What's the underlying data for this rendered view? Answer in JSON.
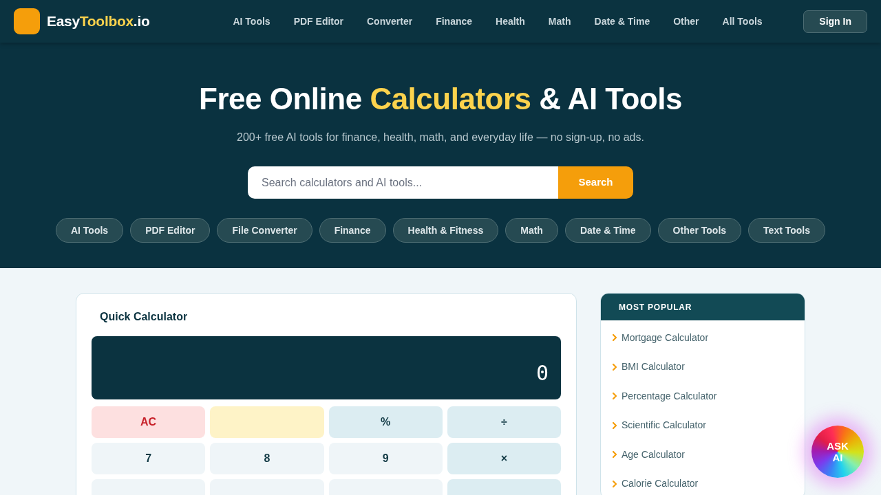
{
  "header": {
    "logo": {
      "parts": [
        {
          "text": "Easy",
          "highlight": false
        },
        {
          "text": "Toolbox",
          "highlight": true
        },
        {
          "text": ".io",
          "highlight": false
        }
      ]
    },
    "nav": [
      "AI Tools",
      "PDF Editor",
      "Converter",
      "Finance",
      "Health",
      "Math",
      "Date & Time",
      "Other",
      "All Tools"
    ],
    "sign_in": "Sign In"
  },
  "hero": {
    "title": [
      {
        "text": "Free Online ",
        "highlight": false
      },
      {
        "text": "Calculators",
        "highlight": true
      },
      {
        "text": " & AI Tools",
        "highlight": false
      }
    ],
    "subtitle": "200+ free AI tools for finance, health, math, and everyday life — no sign-up, no ads.",
    "search": {
      "placeholder": "Search calculators and AI tools...",
      "button": "Search"
    },
    "chips": [
      "AI Tools",
      "PDF Editor",
      "File Converter",
      "Finance",
      "Health & Fitness",
      "Math",
      "Date & Time",
      "Other Tools",
      "Text Tools"
    ]
  },
  "calculator": {
    "title": "Quick Calculator",
    "display": "0",
    "keys": [
      {
        "label": "AC",
        "kind": "clear"
      },
      {
        "kind": "blank"
      },
      {
        "label": "%",
        "kind": "operator"
      },
      {
        "label": "÷",
        "kind": "operator"
      },
      {
        "label": "7",
        "kind": "digit"
      },
      {
        "label": "8",
        "kind": "digit"
      },
      {
        "label": "9",
        "kind": "digit"
      },
      {
        "label": "×",
        "kind": "operator"
      },
      {
        "kind": "digit"
      },
      {
        "kind": "digit"
      },
      {
        "kind": "digit"
      },
      {
        "kind": "operator"
      }
    ]
  },
  "sidebar": {
    "title": "MOST POPULAR",
    "items": [
      "Mortgage Calculator",
      "BMI Calculator",
      "Percentage Calculator",
      "Scientific Calculator",
      "Age Calculator",
      "Calorie Calculator"
    ]
  },
  "ask_ai": {
    "label": "ASK AI"
  }
}
